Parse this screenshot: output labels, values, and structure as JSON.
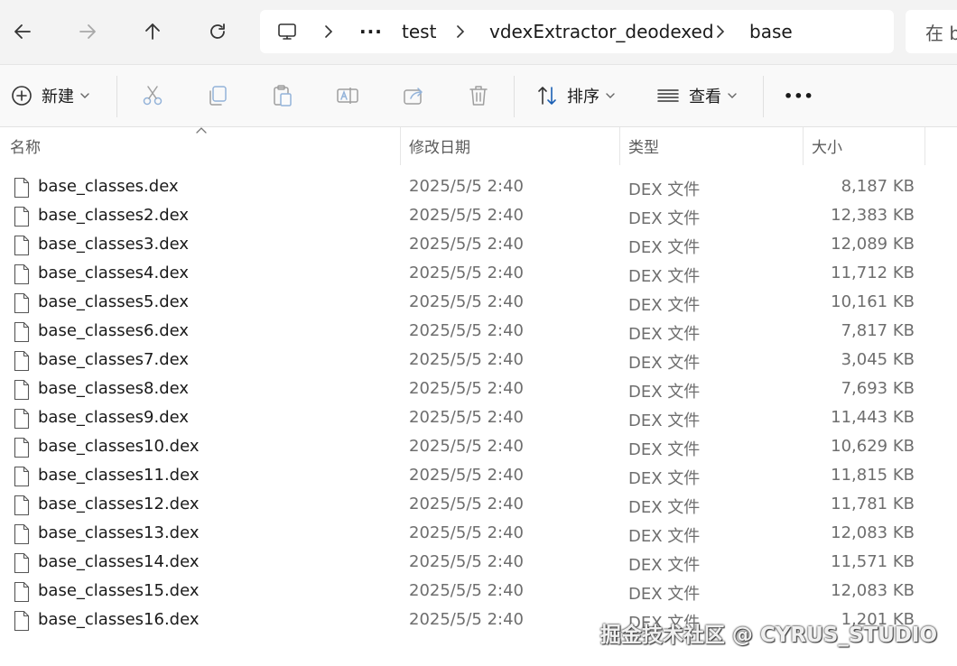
{
  "nav": {
    "back_icon": "arrow-left-icon",
    "forward_icon": "arrow-right-icon",
    "up_icon": "arrow-up-icon",
    "refresh_icon": "refresh-icon"
  },
  "address": {
    "overflow": "···",
    "crumbs": [
      "test",
      "vdexExtractor_deodexed",
      "base"
    ]
  },
  "search": {
    "placeholder": "在 b"
  },
  "toolbar": {
    "new_label": "新建",
    "sort_label": "排序",
    "view_label": "查看",
    "more_label": "•••"
  },
  "columns": {
    "name": "名称",
    "date": "修改日期",
    "type": "类型",
    "size": "大小"
  },
  "files": [
    {
      "name": "base_classes.dex",
      "date": "2025/5/5 2:40",
      "type": "DEX 文件",
      "size": "8,187 KB"
    },
    {
      "name": "base_classes2.dex",
      "date": "2025/5/5 2:40",
      "type": "DEX 文件",
      "size": "12,383 KB"
    },
    {
      "name": "base_classes3.dex",
      "date": "2025/5/5 2:40",
      "type": "DEX 文件",
      "size": "12,089 KB"
    },
    {
      "name": "base_classes4.dex",
      "date": "2025/5/5 2:40",
      "type": "DEX 文件",
      "size": "11,712 KB"
    },
    {
      "name": "base_classes5.dex",
      "date": "2025/5/5 2:40",
      "type": "DEX 文件",
      "size": "10,161 KB"
    },
    {
      "name": "base_classes6.dex",
      "date": "2025/5/5 2:40",
      "type": "DEX 文件",
      "size": "7,817 KB"
    },
    {
      "name": "base_classes7.dex",
      "date": "2025/5/5 2:40",
      "type": "DEX 文件",
      "size": "3,045 KB"
    },
    {
      "name": "base_classes8.dex",
      "date": "2025/5/5 2:40",
      "type": "DEX 文件",
      "size": "7,693 KB"
    },
    {
      "name": "base_classes9.dex",
      "date": "2025/5/5 2:40",
      "type": "DEX 文件",
      "size": "11,443 KB"
    },
    {
      "name": "base_classes10.dex",
      "date": "2025/5/5 2:40",
      "type": "DEX 文件",
      "size": "10,629 KB"
    },
    {
      "name": "base_classes11.dex",
      "date": "2025/5/5 2:40",
      "type": "DEX 文件",
      "size": "11,815 KB"
    },
    {
      "name": "base_classes12.dex",
      "date": "2025/5/5 2:40",
      "type": "DEX 文件",
      "size": "11,781 KB"
    },
    {
      "name": "base_classes13.dex",
      "date": "2025/5/5 2:40",
      "type": "DEX 文件",
      "size": "12,083 KB"
    },
    {
      "name": "base_classes14.dex",
      "date": "2025/5/5 2:40",
      "type": "DEX 文件",
      "size": "11,571 KB"
    },
    {
      "name": "base_classes15.dex",
      "date": "2025/5/5 2:40",
      "type": "DEX 文件",
      "size": "12,083 KB"
    },
    {
      "name": "base_classes16.dex",
      "date": "2025/5/5 2:40",
      "type": "DEX 文件",
      "size": "1,201 KB"
    }
  ],
  "watermark": "掘金技术社区 @ CYRUS_STUDIO",
  "colors": {
    "accent": "#005fb8",
    "window_bg": "#f3f3f3",
    "toolbar_bg": "#f9f9f9"
  }
}
